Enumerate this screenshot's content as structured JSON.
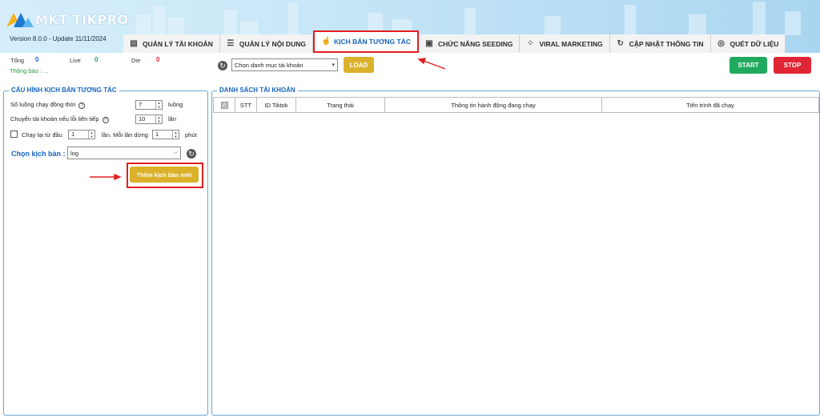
{
  "app": {
    "logo_text": "MKT TIKPRO",
    "version": "Version  8.0.0  - Update  11/11/2024"
  },
  "tabs": [
    {
      "label": "QUẢN LÝ TÀI KHOẢN",
      "icon": "id-card-icon"
    },
    {
      "label": "QUẢN LÝ NỘI DUNG",
      "icon": "list-icon"
    },
    {
      "label": "KỊCH BẢN TƯƠNG TÁC",
      "icon": "hand-pointer-icon",
      "active": true
    },
    {
      "label": "CHỨC NĂNG SEEDING",
      "icon": "dollar-box-icon"
    },
    {
      "label": "VIRAL MARKETING",
      "icon": "nodes-icon"
    },
    {
      "label": "CẬP NHẬT THÔNG TIN",
      "icon": "update-icon"
    },
    {
      "label": "QUÉT DỮ LIỆU",
      "icon": "radar-icon"
    }
  ],
  "stats": {
    "total_label": "Tổng",
    "total_value": "0",
    "live_label": "Live",
    "live_value": "0",
    "die_label": "Die",
    "die_value": "0",
    "notice": "Thông báo : ..."
  },
  "toolbar": {
    "category_select": "Chọn danh mục tài khoản",
    "load_label": "LOAD",
    "start_label": "START",
    "stop_label": "STOP"
  },
  "config": {
    "title": "CẤU HÌNH KỊCH BẢN TƯƠNG TÁC",
    "threads_label": "Số luồng chạy đồng thời",
    "threads_value": "7",
    "threads_unit": "luồng",
    "switch_label": "Chuyển tài khoản nếu lỗi liên tiếp",
    "switch_value": "10",
    "switch_unit": "lần",
    "rerun_label": "Chạy lại từ đầu",
    "rerun_value": "1",
    "rerun_unit": "lần. Mỗi lần dừng",
    "pause_value": "1",
    "pause_unit": "phút",
    "scenario_label": "Chọn kịch bản :",
    "scenario_value": "log",
    "add_scenario_label": "Thêm kịch bản mới"
  },
  "accounts": {
    "title": "DANH SÁCH TÀI KHOẢN",
    "columns": [
      "STT",
      "ID Tiktok",
      "Trạng thái",
      "Thông tin hành động đang chạy",
      "Tiến trình đã chạy"
    ]
  },
  "colors": {
    "accent": "#1565c0",
    "load": "#dbb12a",
    "start": "#1faa5e",
    "stop": "#e02535",
    "annotation": "#e02020"
  }
}
